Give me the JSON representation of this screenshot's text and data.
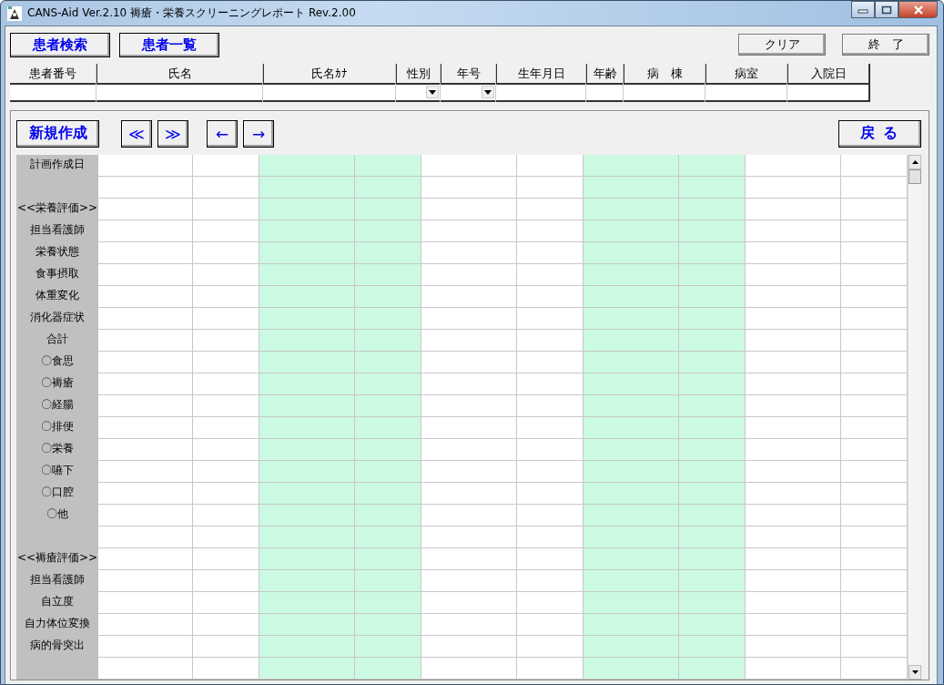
{
  "window": {
    "title": "CANS-Aid Ver.2.10 褥瘡・栄養スクリーニングレポート Rev.2.00"
  },
  "top_buttons": [
    "患者検索",
    "患者一覧"
  ],
  "right_buttons": [
    "クリア",
    "終　了"
  ],
  "patient_fields": [
    {
      "label": "患者番号",
      "kind": "text"
    },
    {
      "label": "氏名",
      "kind": "text"
    },
    {
      "label": "氏名ｶﾅ",
      "kind": "text"
    },
    {
      "label": "性別",
      "kind": "select"
    },
    {
      "label": "年号",
      "kind": "select"
    },
    {
      "label": "生年月日",
      "kind": "text"
    },
    {
      "label": "年齢",
      "kind": "text"
    },
    {
      "label": "病　棟",
      "kind": "text"
    },
    {
      "label": "病室",
      "kind": "text"
    },
    {
      "label": "入院日",
      "kind": "text"
    }
  ],
  "toolbar": {
    "new_button": "新規作成",
    "nav_buttons": [
      "≪",
      "≫",
      "←",
      "→"
    ],
    "back_button": "戻 る"
  },
  "grid": {
    "columns": [
      {
        "shaded": false
      },
      {
        "shaded": false
      },
      {
        "shaded": true
      },
      {
        "shaded": true
      },
      {
        "shaded": false
      },
      {
        "shaded": false
      },
      {
        "shaded": true
      },
      {
        "shaded": true
      },
      {
        "shaded": false
      },
      {
        "shaded": false
      }
    ],
    "rows": [
      {
        "kind": "item",
        "label": "計画作成日"
      },
      {
        "kind": "spacer"
      },
      {
        "kind": "item",
        "label": "<<栄養評価>>"
      },
      {
        "kind": "item",
        "label": "担当看護師"
      },
      {
        "kind": "item",
        "label": "栄養状態"
      },
      {
        "kind": "item",
        "label": "食事摂取"
      },
      {
        "kind": "item",
        "label": "体重変化"
      },
      {
        "kind": "item",
        "label": "消化器症状"
      },
      {
        "kind": "item",
        "label": "合計"
      },
      {
        "kind": "item",
        "label": "〇食思"
      },
      {
        "kind": "item",
        "label": "〇褥瘡"
      },
      {
        "kind": "item",
        "label": "〇経腸"
      },
      {
        "kind": "item",
        "label": "〇排便"
      },
      {
        "kind": "item",
        "label": "〇栄養"
      },
      {
        "kind": "item",
        "label": "〇嚥下"
      },
      {
        "kind": "item",
        "label": "〇口腔"
      },
      {
        "kind": "item",
        "label": "〇他"
      },
      {
        "kind": "spacer"
      },
      {
        "kind": "item",
        "label": "<<褥瘡評価>>"
      },
      {
        "kind": "item",
        "label": "担当看護師"
      },
      {
        "kind": "item",
        "label": "自立度"
      },
      {
        "kind": "item",
        "label": "自力体位変換"
      },
      {
        "kind": "item",
        "label": "病的骨突出"
      },
      {
        "kind": "spacer"
      }
    ]
  }
}
